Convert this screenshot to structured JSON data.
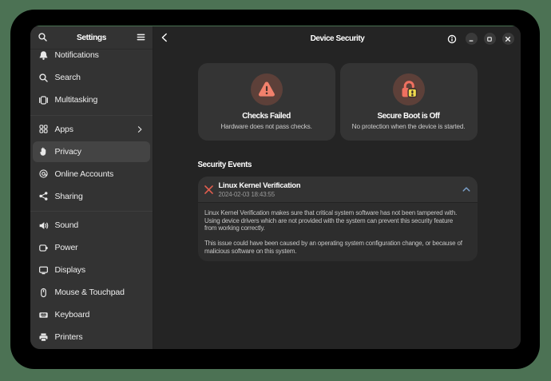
{
  "desktop": {
    "background_color": "#4c7254"
  },
  "window_shadow_color": "#000000",
  "accent_colors": {
    "error_red": "#e25d4e",
    "warning_icon_salmon": "#f3816c",
    "warning_icon_yellow": "#efe14f",
    "icon_circle_brown": "#5d4039",
    "expander_chevron_blue": "#7ba0c9",
    "window_top_highlight_green": "#3e5d45"
  },
  "sidebar": {
    "title": "Settings",
    "search_icon": "search-icon",
    "menu_icon": "hamburger-menu-icon",
    "items": [
      {
        "id": "notifications",
        "label": "Notifications",
        "icon": "bell"
      },
      {
        "id": "search",
        "label": "Search",
        "icon": "search"
      },
      {
        "id": "multitasking",
        "label": "Multitasking",
        "icon": "multitasking"
      },
      {
        "type": "separator"
      },
      {
        "id": "apps",
        "label": "Apps",
        "icon": "apps",
        "chevron": true
      },
      {
        "id": "privacy",
        "label": "Privacy",
        "icon": "privacy",
        "selected": true
      },
      {
        "id": "online-accounts",
        "label": "Online Accounts",
        "icon": "at"
      },
      {
        "id": "sharing",
        "label": "Sharing",
        "icon": "share"
      },
      {
        "type": "separator"
      },
      {
        "id": "sound",
        "label": "Sound",
        "icon": "sound"
      },
      {
        "id": "power",
        "label": "Power",
        "icon": "power"
      },
      {
        "id": "displays",
        "label": "Displays",
        "icon": "displays"
      },
      {
        "id": "mouse-touchpad",
        "label": "Mouse & Touchpad",
        "icon": "mouse"
      },
      {
        "id": "keyboard",
        "label": "Keyboard",
        "icon": "keyboard"
      },
      {
        "id": "printers",
        "label": "Printers",
        "icon": "printer"
      }
    ]
  },
  "headerbar": {
    "back_icon": "back-chevron-icon",
    "title": "Device Security",
    "info_icon": "info-icon",
    "window_controls": [
      "minimize",
      "maximize",
      "close"
    ]
  },
  "summary_cards": [
    {
      "icon": "warning-triangle",
      "title": "Checks Failed",
      "subtitle": "Hardware does not pass checks."
    },
    {
      "icon": "secure-boot-off-lock",
      "title": "Secure Boot is Off",
      "subtitle": "No protection when the device is started."
    }
  ],
  "events_section": {
    "heading": "Security Events",
    "event": {
      "status_icon": "error-cross",
      "title": "Linux Kernel Verification",
      "timestamp": "2024-02-03 18:43:55",
      "expanded": true,
      "description_paragraphs": [
        [
          "Linux Kernel Verification makes sure that critical system software has not been tampered with.",
          "Using device drivers which are not provided with the system can prevent this security feature",
          "from working correctly."
        ],
        [
          "This issue could have been caused by an operating system configuration change, or because of",
          "malicious software on this system."
        ]
      ]
    }
  }
}
